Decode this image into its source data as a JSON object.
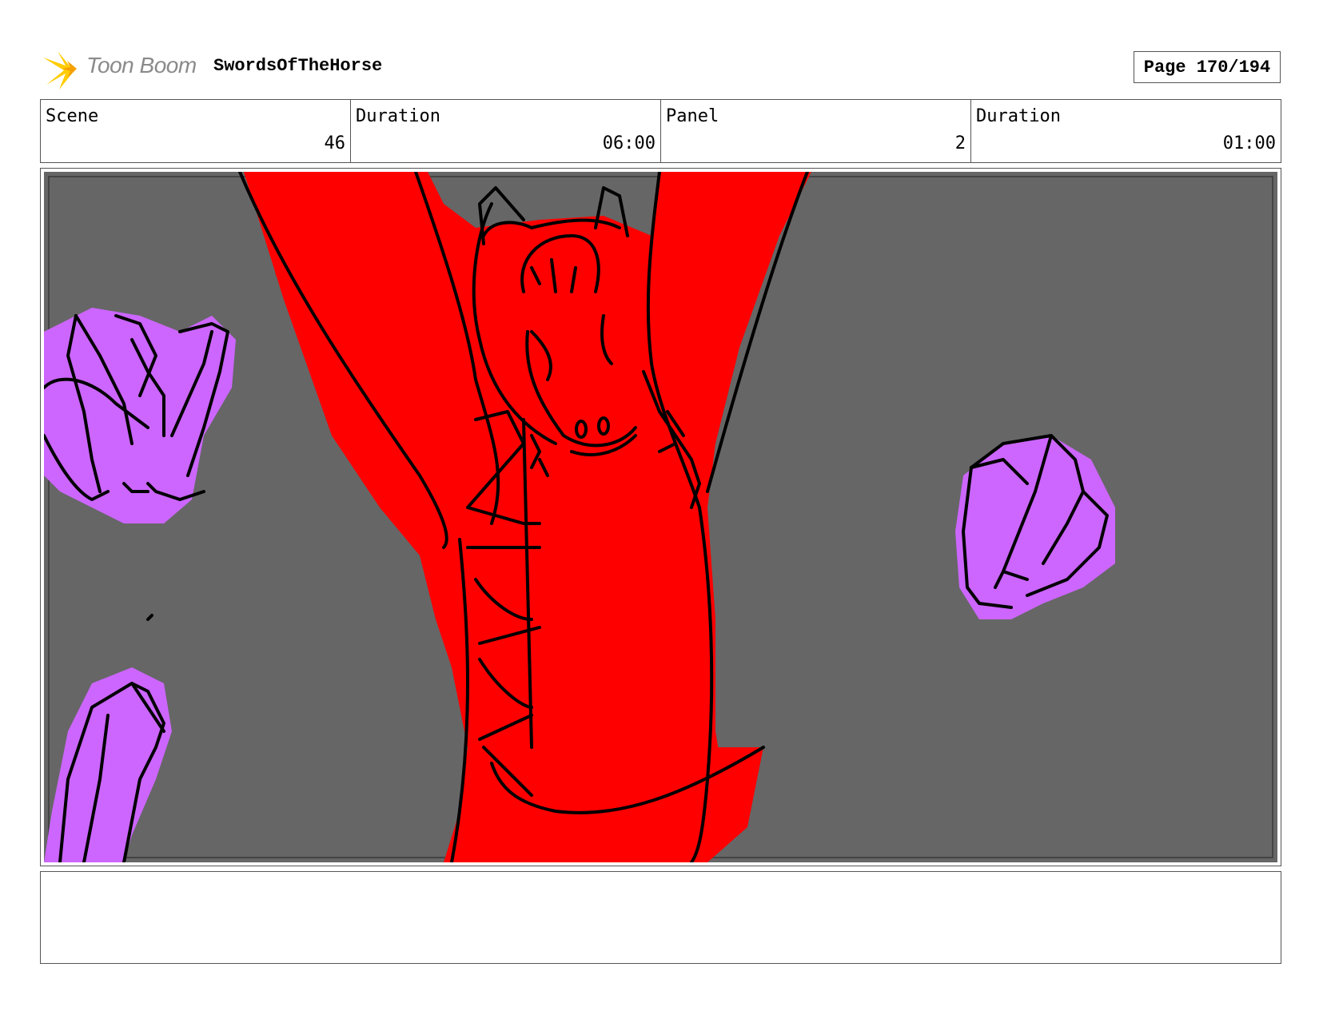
{
  "header": {
    "logo_text": "Toon Boom",
    "project_title": "SwordsOfTheHorse",
    "page_label": "Page 170/194"
  },
  "info": {
    "scene_label": "Scene",
    "scene_value": "46",
    "scene_duration_label": "Duration",
    "scene_duration_value": "06:00",
    "panel_label": "Panel",
    "panel_value": "2",
    "panel_duration_label": "Duration",
    "panel_duration_value": "01:00"
  },
  "notes": {
    "text": ""
  },
  "colors": {
    "background": "#666666",
    "dragon": "#ff0000",
    "crystal": "#cc66ff",
    "logo_star": "#ffcc00",
    "ink": "#000000"
  }
}
